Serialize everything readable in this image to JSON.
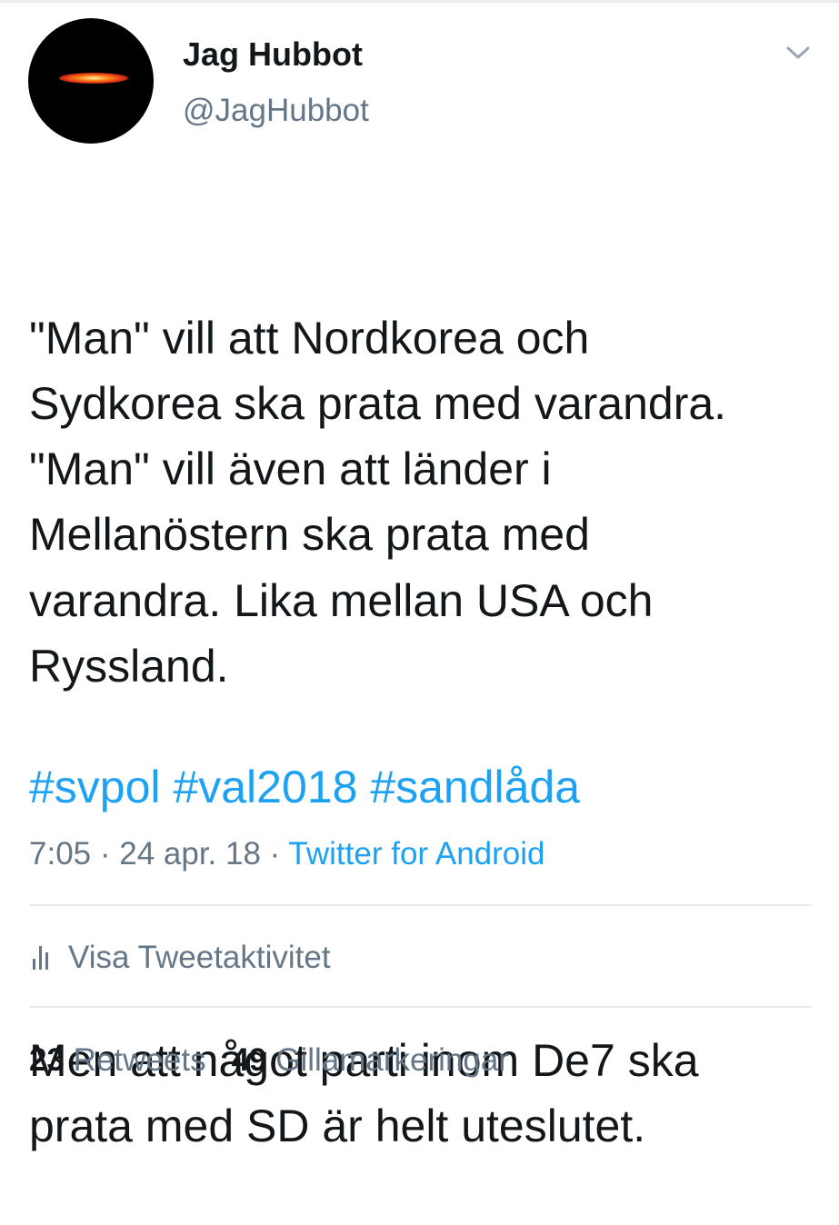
{
  "user": {
    "display_name": "Jag Hubbot",
    "handle": "@JagHubbot"
  },
  "tweet": {
    "paragraphs": [
      "\"Man\" vill att Nordkorea och\nSydkorea ska prata med varandra.\n\"Man\" vill även att länder i\nMellanöstern ska prata med\nvarandra. Lika mellan USA och\nRyssland.",
      "Men att något parti inom De7 ska\nprata med SD är helt uteslutet."
    ],
    "hashtags": [
      "#svpol",
      "#val2018",
      "#sandlåda"
    ]
  },
  "meta": {
    "time": "7:05",
    "separator": " · ",
    "date": "24 apr. 18",
    "source": "Twitter for Android"
  },
  "activity": {
    "label": "Visa Tweetaktivitet",
    "icon": "bar-chart-icon"
  },
  "stats": {
    "retweets_count": "23",
    "retweets_label": "Retweets",
    "likes_count": "49",
    "likes_label": "Gillamarkeringar"
  },
  "colors": {
    "text": "#14171a",
    "secondary": "#657786",
    "link": "#1da1f2",
    "divider": "#e6ecf0"
  }
}
